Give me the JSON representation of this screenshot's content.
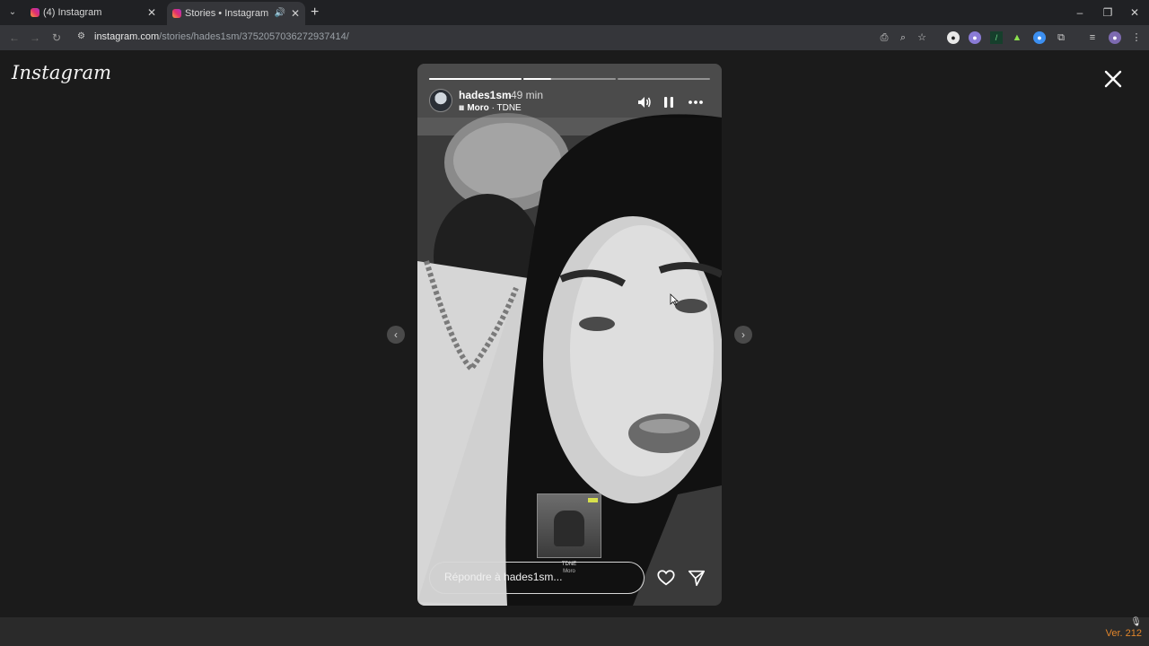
{
  "browser": {
    "tabs": [
      {
        "title": "(4) Instagram",
        "active": false
      },
      {
        "title": "Stories • Instagram",
        "active": true
      }
    ],
    "url_host": "instagram.com",
    "url_path": "/stories/hades1sm/3752057036272937414/"
  },
  "page": {
    "logo": "Instagram"
  },
  "story": {
    "username": "hades1sm",
    "time": "49 min",
    "song": "Moro",
    "artist": " · TDNE",
    "progress_segments": [
      1.0,
      0.3,
      0.0
    ],
    "sticker_artist": "TDNE",
    "sticker_song": "Moro",
    "reply_placeholder": "Répondre à hades1sm..."
  },
  "footer": {
    "version": "Ver. 212"
  },
  "colors": {
    "background": "#1b1b1b",
    "tab_active": "#35363a",
    "version_text": "#e2862b"
  }
}
